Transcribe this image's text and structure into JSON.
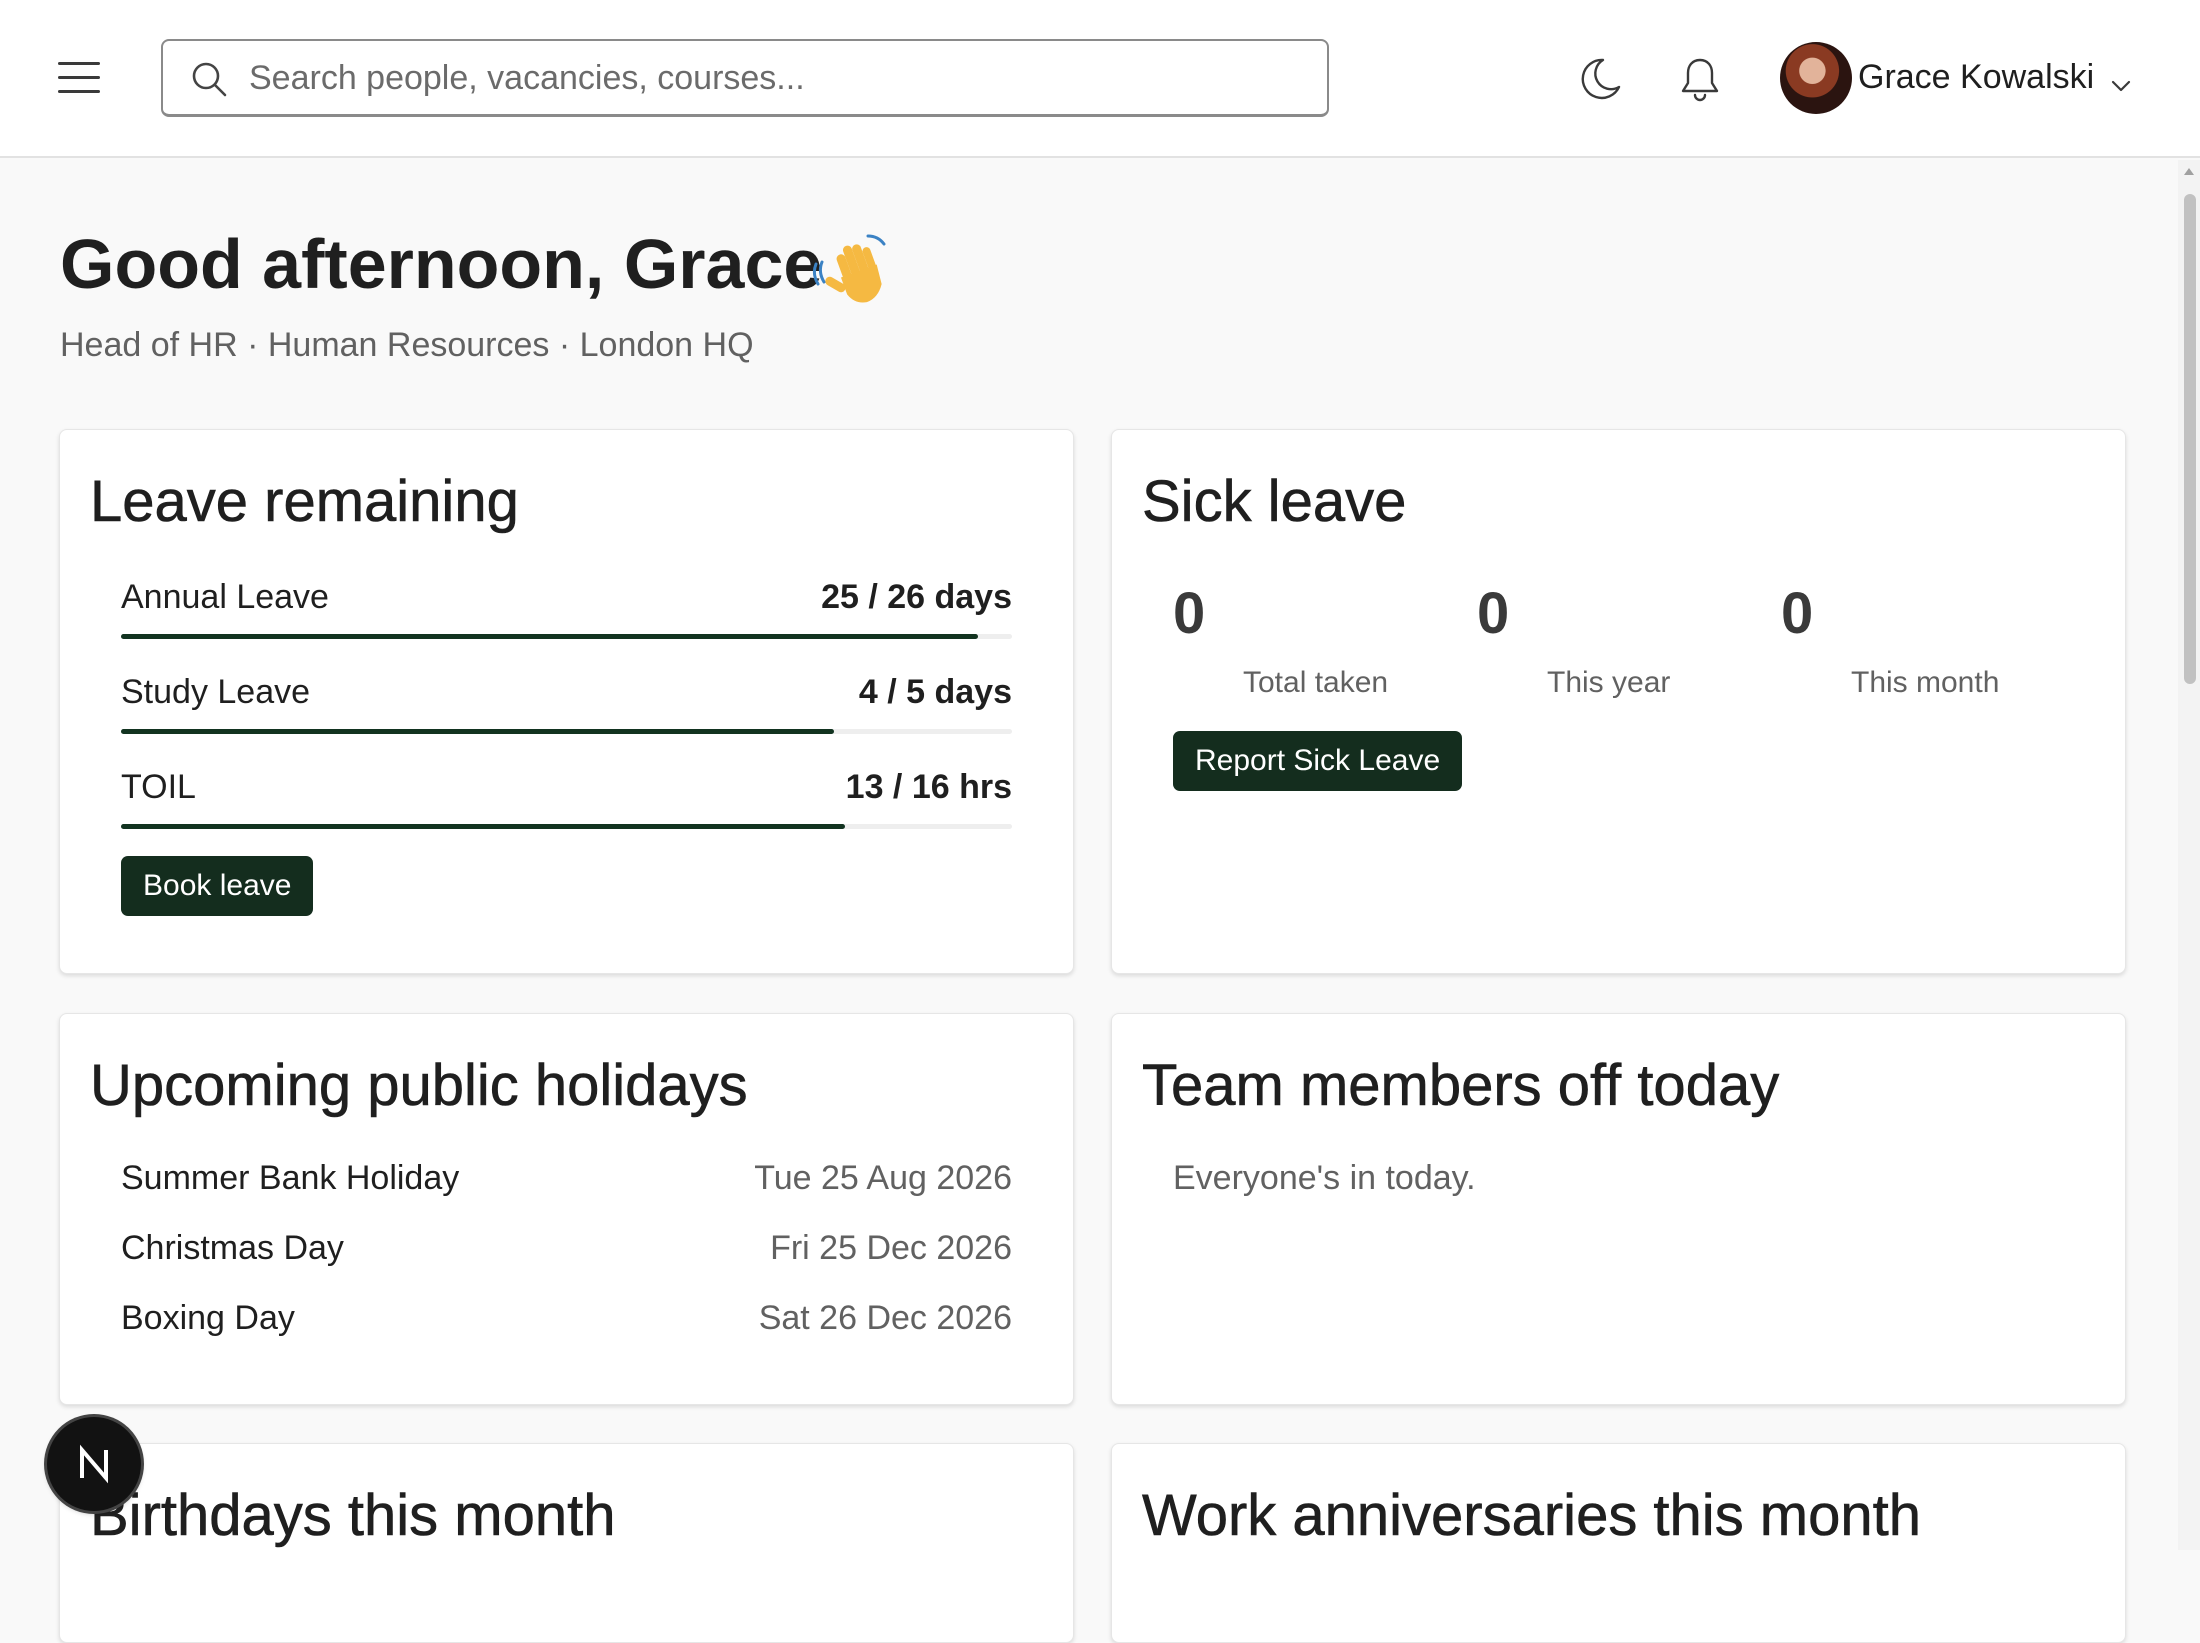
{
  "header": {
    "search_placeholder": "Search people, vacancies, courses...",
    "user_name": "Grace Kowalski",
    "icons": [
      "menu-icon",
      "search-icon",
      "moon-icon",
      "bell-icon",
      "chevron-down-icon"
    ]
  },
  "greeting": {
    "title": "Good afternoon, Grace",
    "emoji": "waving-hand",
    "subtitle": "Head of HR · Human Resources · London HQ"
  },
  "leave_remaining": {
    "title": "Leave remaining",
    "items": [
      {
        "label": "Annual Leave",
        "value": "25 / 26 days",
        "used": 25,
        "total": 26
      },
      {
        "label": "Study Leave",
        "value": "4 / 5 days",
        "used": 4,
        "total": 5
      },
      {
        "label": "TOIL",
        "value": "13 / 16 hrs",
        "used": 13,
        "total": 16
      }
    ],
    "button_label": "Book leave"
  },
  "sick_leave": {
    "title": "Sick leave",
    "stats": [
      {
        "value": "0",
        "label": "Total taken"
      },
      {
        "value": "0",
        "label": "This year"
      },
      {
        "value": "0",
        "label": "This month"
      }
    ],
    "button_label": "Report Sick Leave"
  },
  "public_holidays": {
    "title": "Upcoming public holidays",
    "items": [
      {
        "name": "Summer Bank Holiday",
        "date": "Tue 25 Aug 2026"
      },
      {
        "name": "Christmas Day",
        "date": "Fri 25 Dec 2026"
      },
      {
        "name": "Boxing Day",
        "date": "Sat 26 Dec 2026"
      }
    ]
  },
  "team_off": {
    "title": "Team members off today",
    "empty_text": "Everyone's in today."
  },
  "birthdays": {
    "title": "Birthdays this month"
  },
  "anniversaries": {
    "title": "Work anniversaries this month"
  },
  "fab": {
    "label": "N"
  },
  "colors": {
    "accent": "#142d1e",
    "progress_fill": "#123320",
    "background": "#f9f9f9"
  }
}
